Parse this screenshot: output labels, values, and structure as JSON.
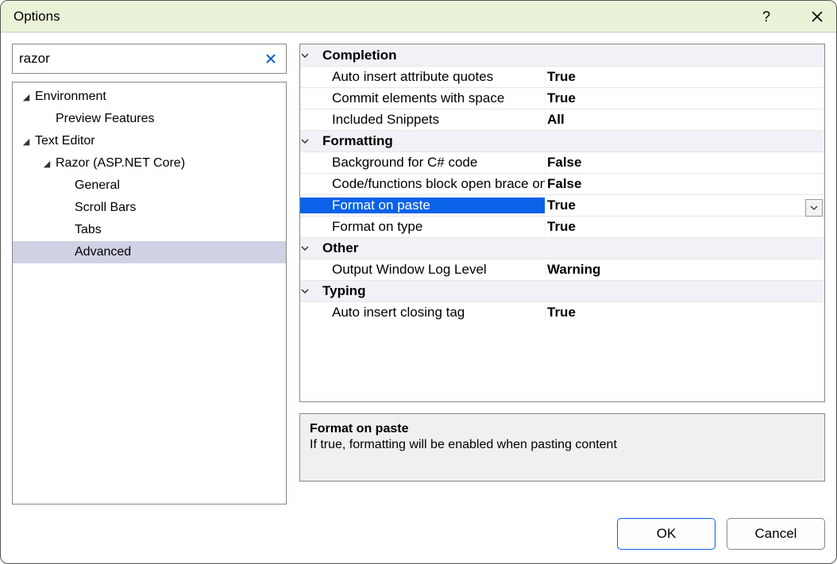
{
  "title": "Options",
  "search": {
    "value": "razor"
  },
  "tree": [
    {
      "label": "Environment",
      "level": 0,
      "expanded": true,
      "hasChildren": true,
      "selected": false
    },
    {
      "label": "Preview Features",
      "level": 1,
      "expanded": false,
      "hasChildren": false,
      "selected": false
    },
    {
      "label": "Text Editor",
      "level": 0,
      "expanded": true,
      "hasChildren": true,
      "selected": false
    },
    {
      "label": "Razor (ASP.NET Core)",
      "level": 1,
      "expanded": true,
      "hasChildren": true,
      "selected": false
    },
    {
      "label": "General",
      "level": 2,
      "expanded": false,
      "hasChildren": false,
      "selected": false
    },
    {
      "label": "Scroll Bars",
      "level": 2,
      "expanded": false,
      "hasChildren": false,
      "selected": false
    },
    {
      "label": "Tabs",
      "level": 2,
      "expanded": false,
      "hasChildren": false,
      "selected": false
    },
    {
      "label": "Advanced",
      "level": 2,
      "expanded": false,
      "hasChildren": false,
      "selected": true
    }
  ],
  "propgrid": [
    {
      "type": "cat",
      "label": "Completion"
    },
    {
      "type": "prop",
      "name": "Auto insert attribute quotes",
      "value": "True",
      "selected": false
    },
    {
      "type": "prop",
      "name": "Commit elements with space",
      "value": "True",
      "selected": false
    },
    {
      "type": "prop",
      "name": "Included Snippets",
      "value": "All",
      "selected": false
    },
    {
      "type": "cat",
      "label": "Formatting"
    },
    {
      "type": "prop",
      "name": "Background for C# code",
      "value": "False",
      "selected": false
    },
    {
      "type": "prop",
      "name": "Code/functions block open brace on",
      "value": "False",
      "selected": false
    },
    {
      "type": "prop",
      "name": "Format on paste",
      "value": "True",
      "selected": true
    },
    {
      "type": "prop",
      "name": "Format on type",
      "value": "True",
      "selected": false
    },
    {
      "type": "cat",
      "label": "Other"
    },
    {
      "type": "prop",
      "name": "Output Window Log Level",
      "value": "Warning",
      "selected": false
    },
    {
      "type": "cat",
      "label": "Typing"
    },
    {
      "type": "prop",
      "name": "Auto insert closing tag",
      "value": "True",
      "selected": false
    }
  ],
  "description": {
    "title": "Format on paste",
    "body": "If true, formatting will be enabled when pasting content"
  },
  "buttons": {
    "ok": "OK",
    "cancel": "Cancel"
  }
}
